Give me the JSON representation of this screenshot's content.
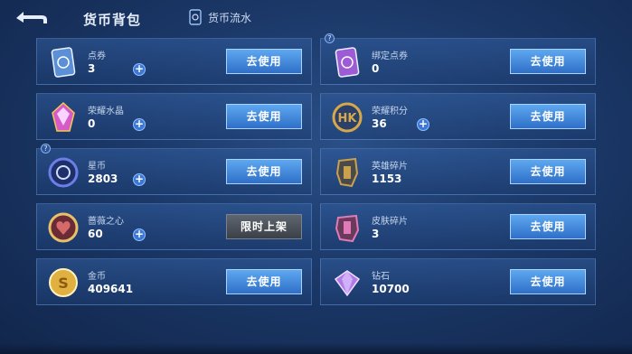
{
  "header": {
    "title": "货币背包",
    "flow_label": "货币流水"
  },
  "cards": [
    {
      "name": "点券",
      "amount": "3",
      "button": "去使用",
      "plus": true,
      "help": false,
      "icon": "ticket-icon",
      "color": "#5b8fd6"
    },
    {
      "name": "绑定点券",
      "amount": "0",
      "button": "去使用",
      "plus": false,
      "help": true,
      "icon": "bound-ticket-icon",
      "color": "#9d5bd6"
    },
    {
      "name": "荣耀水晶",
      "amount": "0",
      "button": "去使用",
      "plus": true,
      "help": false,
      "icon": "glory-crystal-icon",
      "color": "#d65bc8"
    },
    {
      "name": "荣耀积分",
      "amount": "36",
      "button": "去使用",
      "plus": true,
      "help": false,
      "icon": "glory-points-icon",
      "color": "#d6a84a"
    },
    {
      "name": "星币",
      "amount": "2803",
      "button": "去使用",
      "plus": true,
      "help": true,
      "icon": "star-coin-icon",
      "color": "#6a7fe8"
    },
    {
      "name": "英雄碎片",
      "amount": "1153",
      "button": "去使用",
      "plus": false,
      "help": false,
      "icon": "hero-fragment-icon",
      "color": "#c9a04e"
    },
    {
      "name": "蔷薇之心",
      "amount": "60",
      "button": "限时上架",
      "plus": true,
      "help": false,
      "disabled": true,
      "icon": "rose-heart-icon",
      "color": "#d66a6a"
    },
    {
      "name": "皮肤碎片",
      "amount": "3",
      "button": "去使用",
      "plus": false,
      "help": false,
      "icon": "skin-fragment-icon",
      "color": "#e07ab8"
    },
    {
      "name": "金币",
      "amount": "409641",
      "button": "去使用",
      "plus": false,
      "help": false,
      "icon": "gold-coin-icon",
      "color": "#e0b040"
    },
    {
      "name": "钻石",
      "amount": "10700",
      "button": "去使用",
      "plus": false,
      "help": false,
      "icon": "diamond-icon",
      "color": "#b07ae8"
    }
  ]
}
